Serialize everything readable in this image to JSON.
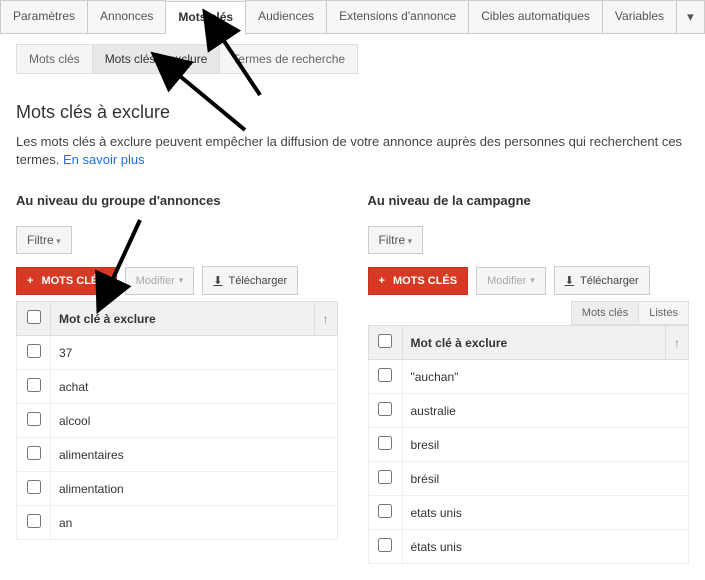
{
  "main_tabs": {
    "t0": "Paramètres",
    "t1": "Annonces",
    "t2": "Mots clés",
    "t3": "Audiences",
    "t4": "Extensions d'annonce",
    "t5": "Cibles automatiques",
    "t6": "Variables",
    "more": "▾"
  },
  "sub_tabs": {
    "s0": "Mots clés",
    "s1": "Mots clés à exclure",
    "s2": "Termes de recherche"
  },
  "page_title": "Mots clés à exclure",
  "desc_text": "Les mots clés à exclure peuvent empêcher la diffusion de votre annonce auprès des personnes qui recherchent ces termes. ",
  "learn_more": "En savoir plus",
  "left": {
    "title": "Au niveau du groupe d'annonces",
    "filter": "Filtre",
    "add": "MOTS CLÉS",
    "modify": "Modifier",
    "download": "Télécharger",
    "header": "Mot clé à exclure",
    "sort": "↑",
    "rows": {
      "r0": "37",
      "r1": "achat",
      "r2": "alcool",
      "r3": "alimentaires",
      "r4": "alimentation",
      "r5": "an"
    }
  },
  "right": {
    "title": "Au niveau de la campagne",
    "filter": "Filtre",
    "add": "MOTS CLÉS",
    "modify": "Modifier",
    "download": "Télécharger",
    "mini": {
      "m0": "Mots clés",
      "m1": "Listes"
    },
    "header": "Mot clé à exclure",
    "sort": "↑",
    "rows": {
      "r0": "\"auchan\"",
      "r1": "australie",
      "r2": "bresil",
      "r3": "brésil",
      "r4": "etats unis",
      "r5": "états unis"
    }
  }
}
